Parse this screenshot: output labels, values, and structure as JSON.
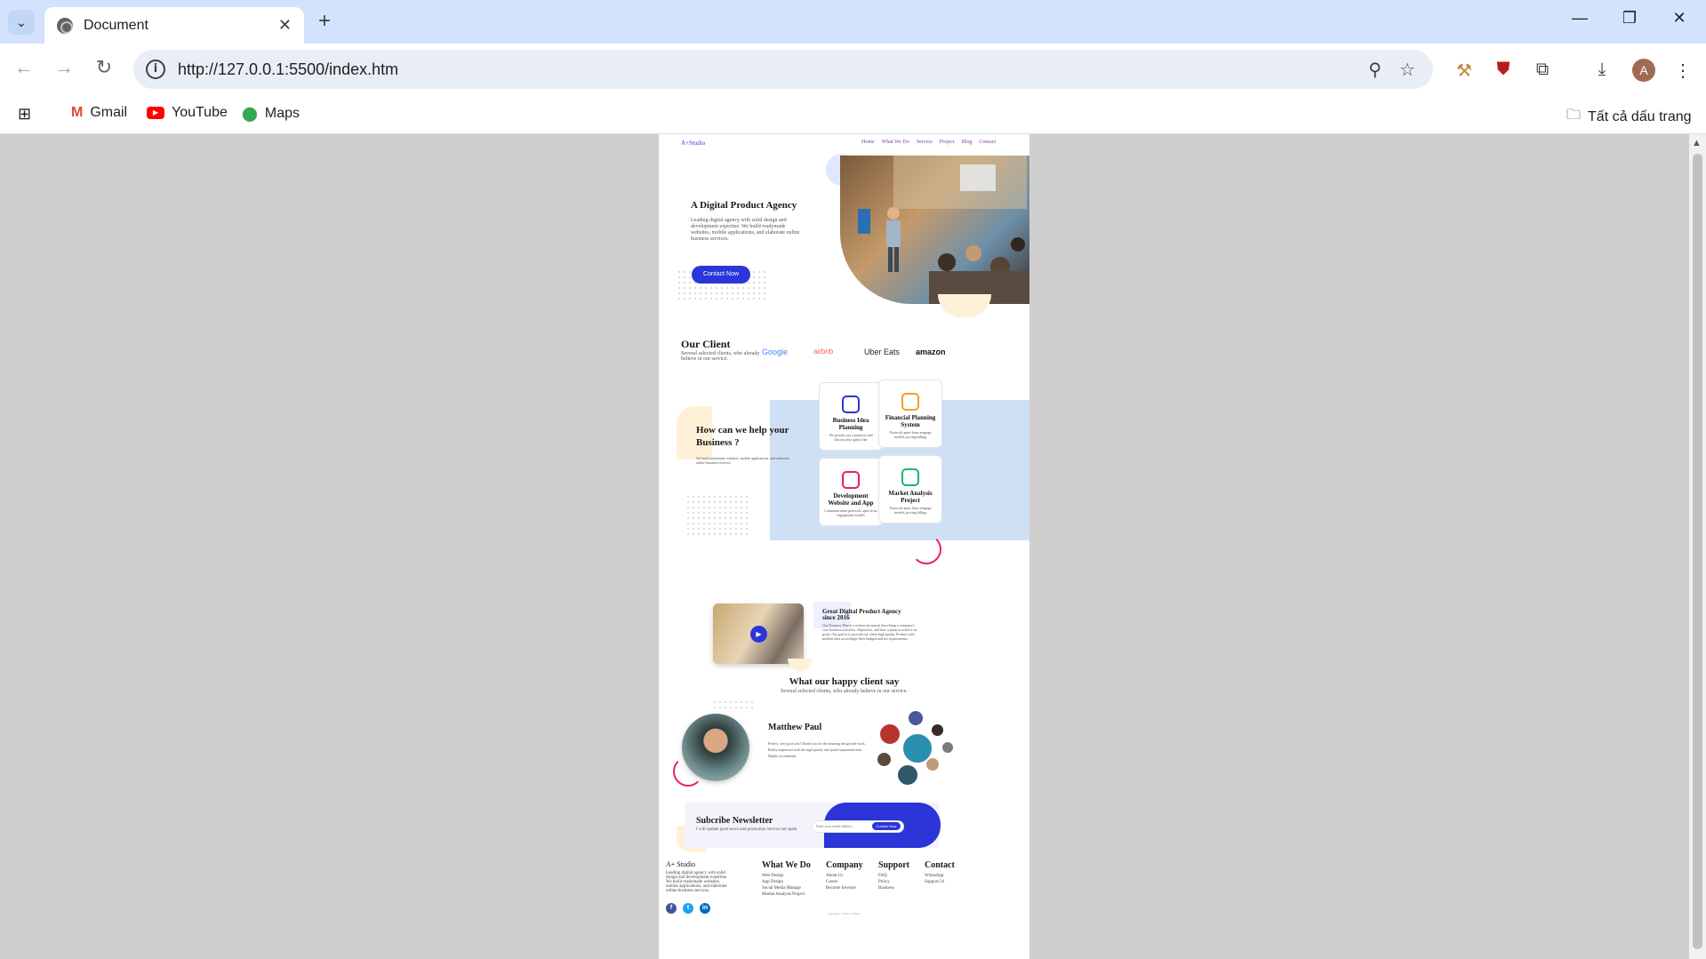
{
  "browser": {
    "tab_title": "Document",
    "url": "http://127.0.0.1:5500/index.htm",
    "avatar_letter": "A",
    "bookmarks": [
      {
        "label": "Gmail"
      },
      {
        "label": "YouTube"
      },
      {
        "label": "Maps"
      }
    ],
    "all_bookmarks_label": "Tất cả dấu trang"
  },
  "site": {
    "logo": "A+Studio",
    "nav": [
      "Home",
      "What We Do",
      "Service",
      "Project",
      "Blog",
      "Contact"
    ],
    "hero": {
      "title": "A Digital Product Agency",
      "desc": "Leading digital agency with solid design and development expertise. We build readymade websites, mobile applications, and elaborate online business services.",
      "button": "Contact Now"
    },
    "clients": {
      "title": "Our Client",
      "desc": "Several selected clients, who already believe in our service.",
      "logos": [
        "Google",
        "airbnb",
        "Uber Eats",
        "amazon"
      ]
    },
    "help": {
      "title": "How can we help your Business ?",
      "desc": "We build readymade websites, mobile applications, and elaborate online business services.",
      "cards": [
        {
          "title": "Business Idea Planning",
          "desc": "We present you a proposal and discuss nitty-gritty like"
        },
        {
          "title": "Financial Planning System",
          "desc": "Protocols apart from aengage models, pricing billing"
        },
        {
          "title": "Development Website and App",
          "desc": "Communication protocols apart from engagement models"
        },
        {
          "title": "Market Analysis Project",
          "desc": "Protocols apart from aengage models, pricing billing"
        }
      ]
    },
    "about": {
      "title": "Great Digital Product Agency since 2016",
      "desc": "Our Business Plan is a written document describing a company's core business activities, Objectives, and how it plans to achieve its goals. Our goal is to provide our client high quality Product with modern idea accordingly their budgets and his requirements."
    },
    "testimonial": {
      "title": "What our happy client say",
      "subtitle": "Several selected clients, who already believe in our service.",
      "name": "Matthew Paul",
      "quote": "Perfect, very good job! Thank you for the amazing design and work. Really impressed with the high quality and quick turnaround time. Highly recommend."
    },
    "newsletter": {
      "title": "Subcribe Newsletter",
      "desc": "I will update good news and promotion service not spam",
      "placeholder": "Enter your email address..",
      "button": "Contact Now"
    },
    "footer": {
      "brand": "A+ Studio",
      "desc": "Leading digital agency with solid design and development expertise. We build readymade websites, mobile applications, and elaborate online business services.",
      "columns": [
        {
          "heading": "What We Do",
          "items": [
            "Web Design",
            "App Design",
            "Social Media Manage",
            "Market Analysis Project"
          ]
        },
        {
          "heading": "Company",
          "items": [
            "About Us",
            "Career",
            "Become Investor"
          ]
        },
        {
          "heading": "Support",
          "items": [
            "FAQ",
            "Policy",
            "Business"
          ]
        },
        {
          "heading": "Contact",
          "items": [
            "WhatsApp",
            "Support 24"
          ]
        }
      ],
      "copyright": "Copyright © 2022 A+ Studio"
    }
  },
  "colors": {
    "accent": "#2b35d8",
    "pink": "#e91e63",
    "light_blue": "#cfe0f5",
    "cream": "#fff1d8"
  }
}
